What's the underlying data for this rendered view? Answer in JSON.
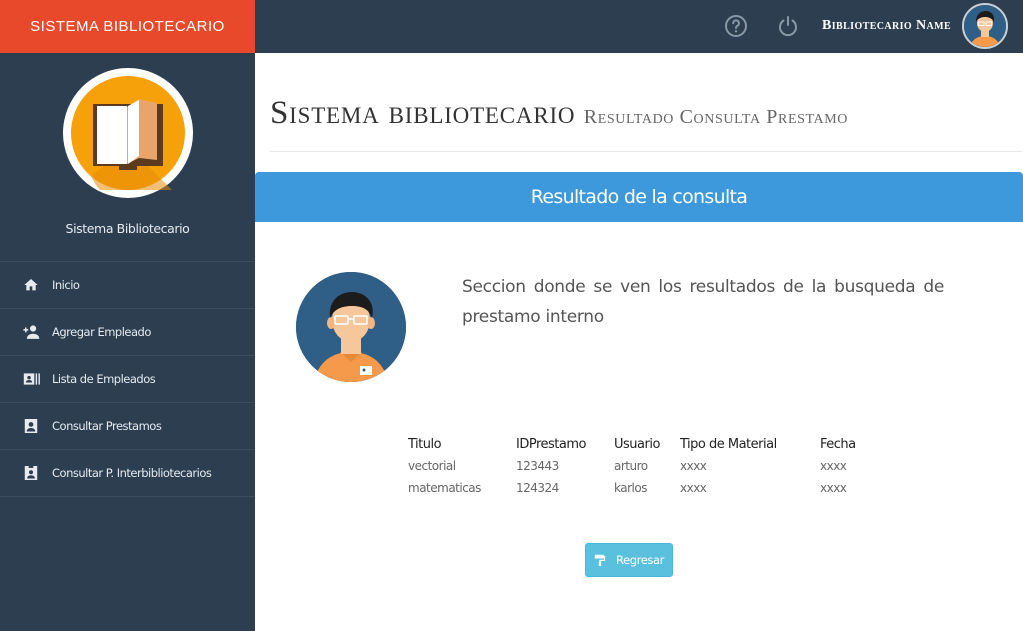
{
  "app": {
    "brand": "SISTEMA BIBLIOTECARIO"
  },
  "topbar": {
    "user_name": "Bibliotecario Name",
    "help_icon": "help-circle-icon",
    "power_icon": "power-icon"
  },
  "sidebar": {
    "profile_name": "Sistema Bibliotecario",
    "items": [
      {
        "label": "Inicio",
        "icon": "home-icon"
      },
      {
        "label": "Agregar Empleado",
        "icon": "person-add-icon"
      },
      {
        "label": "Lista de Empleados",
        "icon": "contact-list-icon"
      },
      {
        "label": "Consultar Prestamos",
        "icon": "portrait-icon"
      },
      {
        "label": "Consultar P. Interbibliotecarios",
        "icon": "badge-icon"
      }
    ]
  },
  "header": {
    "title": "Sistema bibliotecario",
    "subtitle": "Resultado Consulta Prestamo"
  },
  "panel": {
    "title": "Resultado de la consulta"
  },
  "main": {
    "description": "Seccion donde se ven los resultados de la busqueda de prestamo interno"
  },
  "table": {
    "headers": [
      "Titulo",
      "IDPrestamo",
      "Usuario",
      "Tipo de Material",
      "Fecha"
    ],
    "rows": [
      [
        "vectorial",
        "123443",
        "arturo",
        "xxxx",
        "xxxx"
      ],
      [
        "matematicas",
        "124324",
        "karlos",
        "xxxx",
        "xxxx"
      ]
    ]
  },
  "actions": {
    "back_label": "Regresar"
  },
  "colors": {
    "brand": "#e9492b",
    "sidebar": "#2c3e50",
    "panel": "#3d99dc",
    "button": "#5bc0de"
  }
}
